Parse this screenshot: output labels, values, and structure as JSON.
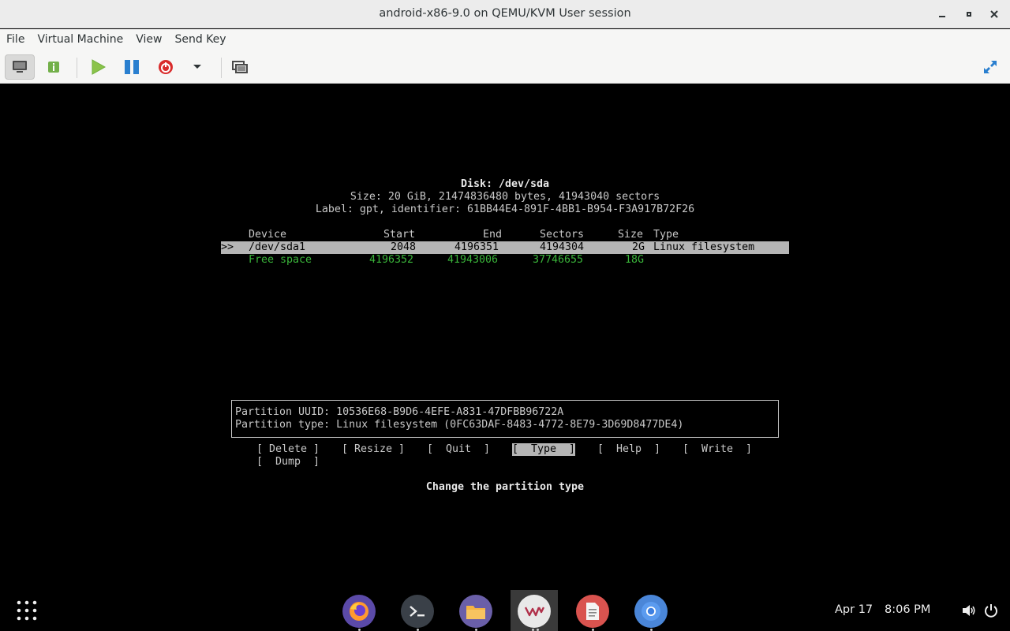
{
  "window": {
    "title": "android-x86-9.0 on QEMU/KVM User session"
  },
  "menubar": {
    "items": [
      "File",
      "Virtual Machine",
      "View",
      "Send Key"
    ]
  },
  "toolbar": {
    "icons": [
      "monitor-icon",
      "info-icon",
      "play-icon",
      "pause-icon",
      "power-icon",
      "dropdown-arrow-icon",
      "snapshot-icon",
      "fullscreen-icon"
    ]
  },
  "console": {
    "disk_line": "Disk: /dev/sda",
    "size_line": "Size: 20 GiB, 21474836480 bytes, 41943040 sectors",
    "label_line": "Label: gpt, identifier: 61BB44E4-891F-4BB1-B954-F3A917B72F26",
    "headers": {
      "device": "Device",
      "start": "Start",
      "end": "End",
      "sectors": "Sectors",
      "size": "Size",
      "type": "Type"
    },
    "rows": [
      {
        "marker": ">>",
        "device": "/dev/sda1",
        "start": "2048",
        "end": "4196351",
        "sectors": "4194304",
        "size": "2G",
        "type": "Linux filesystem"
      },
      {
        "marker": "",
        "device": "Free space",
        "start": "4196352",
        "end": "41943006",
        "sectors": "37746655",
        "size": "18G",
        "type": ""
      }
    ],
    "info": {
      "uuid_line": "Partition UUID: 10536E68-B9D6-4EFE-A831-47DFBB96722A",
      "type_line": "Partition type: Linux filesystem (0FC63DAF-8483-4772-8E79-3D69D8477DE4)"
    },
    "actions": [
      "[ Delete ]",
      "[ Resize ]",
      "[  Quit  ]",
      "[  Type  ]",
      "[  Help  ]",
      "[  Write  ]",
      "[  Dump  ]"
    ],
    "selected_action": "[  Type  ]",
    "hint": "Change the partition type"
  },
  "taskbar": {
    "apps": [
      "app-grid-icon",
      "firefox-icon",
      "terminal-icon",
      "files-icon",
      "virt-manager-icon",
      "text-editor-icon",
      "chromium-icon"
    ],
    "date": "Apr 17",
    "time": "8:06 PM"
  },
  "colors": {
    "free_space": "#3ab53a",
    "selection": "#b5b5b5",
    "play_green": "#6fb03a",
    "pause_blue": "#2a7fcf",
    "power_red": "#d92b2b"
  }
}
